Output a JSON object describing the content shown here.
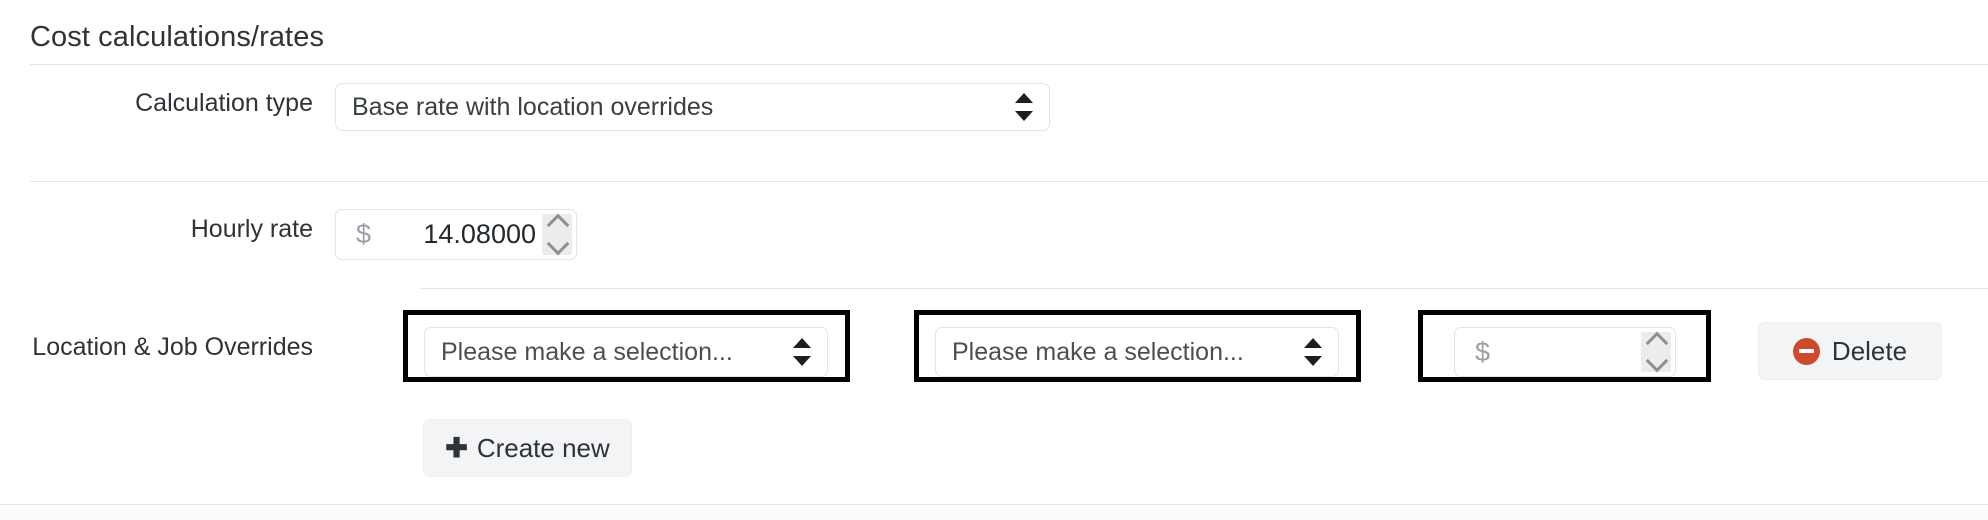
{
  "section": {
    "title": "Cost calculations/rates"
  },
  "fields": {
    "calculation_type": {
      "label": "Calculation type",
      "value": "Base rate with location overrides",
      "control": "select"
    },
    "hourly_rate": {
      "label": "Hourly rate",
      "currency_symbol": "$",
      "value": "14.08000",
      "control": "number"
    },
    "overrides": {
      "label": "Location & Job Overrides",
      "rows": [
        {
          "location_select": {
            "value": "Please make a selection...",
            "highlighted": true
          },
          "job_select": {
            "value": "Please make a selection...",
            "highlighted": true
          },
          "rate_input": {
            "currency_symbol": "$",
            "value": "",
            "highlighted": true
          },
          "delete_label": "Delete"
        }
      ],
      "create_label": "Create new",
      "create_icon": "plus-icon",
      "delete_icon": "minus-circle-icon"
    }
  },
  "colors": {
    "delete_icon": "#cc4b2f",
    "highlight_border": "#000000",
    "divider": "#e4e6e8",
    "button_bg": "#f3f4f5",
    "text": "#2f3337",
    "placeholder": "#9aa0a6"
  }
}
